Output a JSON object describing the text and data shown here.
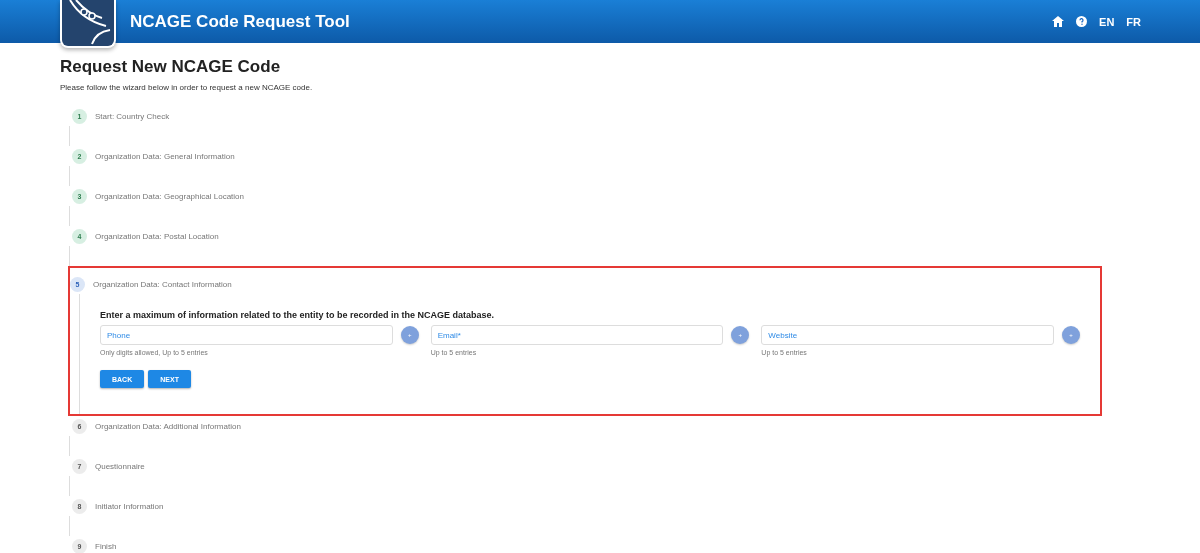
{
  "header": {
    "title": "NCAGE Code Request Tool",
    "languages": [
      "EN",
      "FR"
    ]
  },
  "page": {
    "title": "Request New NCAGE Code",
    "intro": "Please follow the wizard below in order to request a new NCAGE code."
  },
  "steps": [
    {
      "number": "1",
      "label": "Start: Country Check",
      "kind": "done"
    },
    {
      "number": "2",
      "label": "Organization Data: General Information",
      "kind": "done"
    },
    {
      "number": "3",
      "label": "Organization Data: Geographical Location",
      "kind": "done"
    },
    {
      "number": "4",
      "label": "Organization Data: Postal Location",
      "kind": "done"
    },
    {
      "number": "5",
      "label": "Organization Data: Contact Information",
      "kind": "active",
      "highlighted": true,
      "instruction": "Enter a maximum of information related to the entity to be recorded in the NCAGE database.",
      "fields": [
        {
          "placeholder": "Phone",
          "hint": "Only digits allowed, Up to 5 entries",
          "add": "+"
        },
        {
          "placeholder": "Email*",
          "hint": "Up to 5 entries",
          "add": "+"
        },
        {
          "placeholder": "Website",
          "hint": "Up to 5 entries",
          "add": "+"
        }
      ],
      "buttons": [
        "BACK",
        "NEXT"
      ]
    },
    {
      "number": "6",
      "label": "Organization Data: Additional Information",
      "kind": "todo"
    },
    {
      "number": "7",
      "label": "Questionnaire",
      "kind": "todo"
    },
    {
      "number": "8",
      "label": "Initiator Information",
      "kind": "todo"
    },
    {
      "number": "9",
      "label": "Finish",
      "kind": "todo"
    }
  ]
}
